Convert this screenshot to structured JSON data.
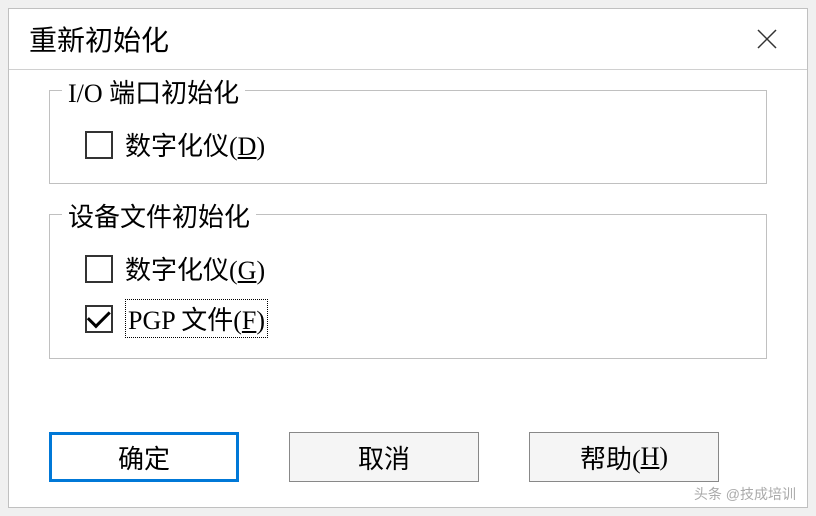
{
  "dialog": {
    "title": "重新初始化"
  },
  "group1": {
    "title": "I/O 端口初始化",
    "digitizer": {
      "label": "数字化仪(",
      "accel": "D",
      "suffix": ")",
      "checked": false
    }
  },
  "group2": {
    "title": "设备文件初始化",
    "digitizer": {
      "label": "数字化仪(",
      "accel": "G",
      "suffix": ")",
      "checked": false
    },
    "pgp": {
      "label": "PGP 文件(",
      "accel": "F",
      "suffix": ")",
      "checked": true
    }
  },
  "buttons": {
    "ok": "确定",
    "cancel": "取消",
    "help_pre": "帮助(",
    "help_accel": "H",
    "help_suf": ")"
  },
  "watermark": "头条 @技成培训"
}
